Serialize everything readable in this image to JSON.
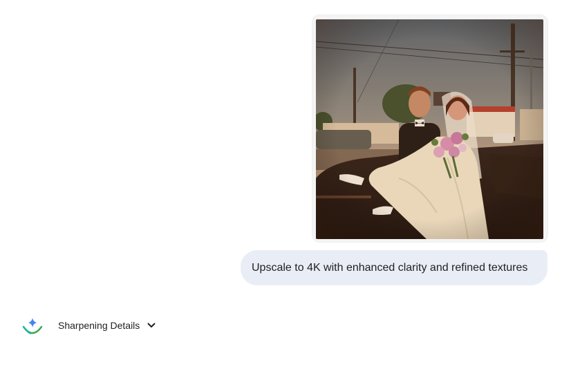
{
  "message": {
    "user_prompt": "Upscale to 4K with enhanced clarity and refined textures"
  },
  "response": {
    "thinking_label": "Sharpening Details",
    "icons": {
      "assistant": "sparkle-icon",
      "expand": "chevron-down-icon"
    }
  },
  "colors": {
    "bubble_bg": "#e9eef6",
    "text": "#1f1f1f",
    "spark_blue": "#4285f4",
    "spark_arc": "#34a853"
  }
}
